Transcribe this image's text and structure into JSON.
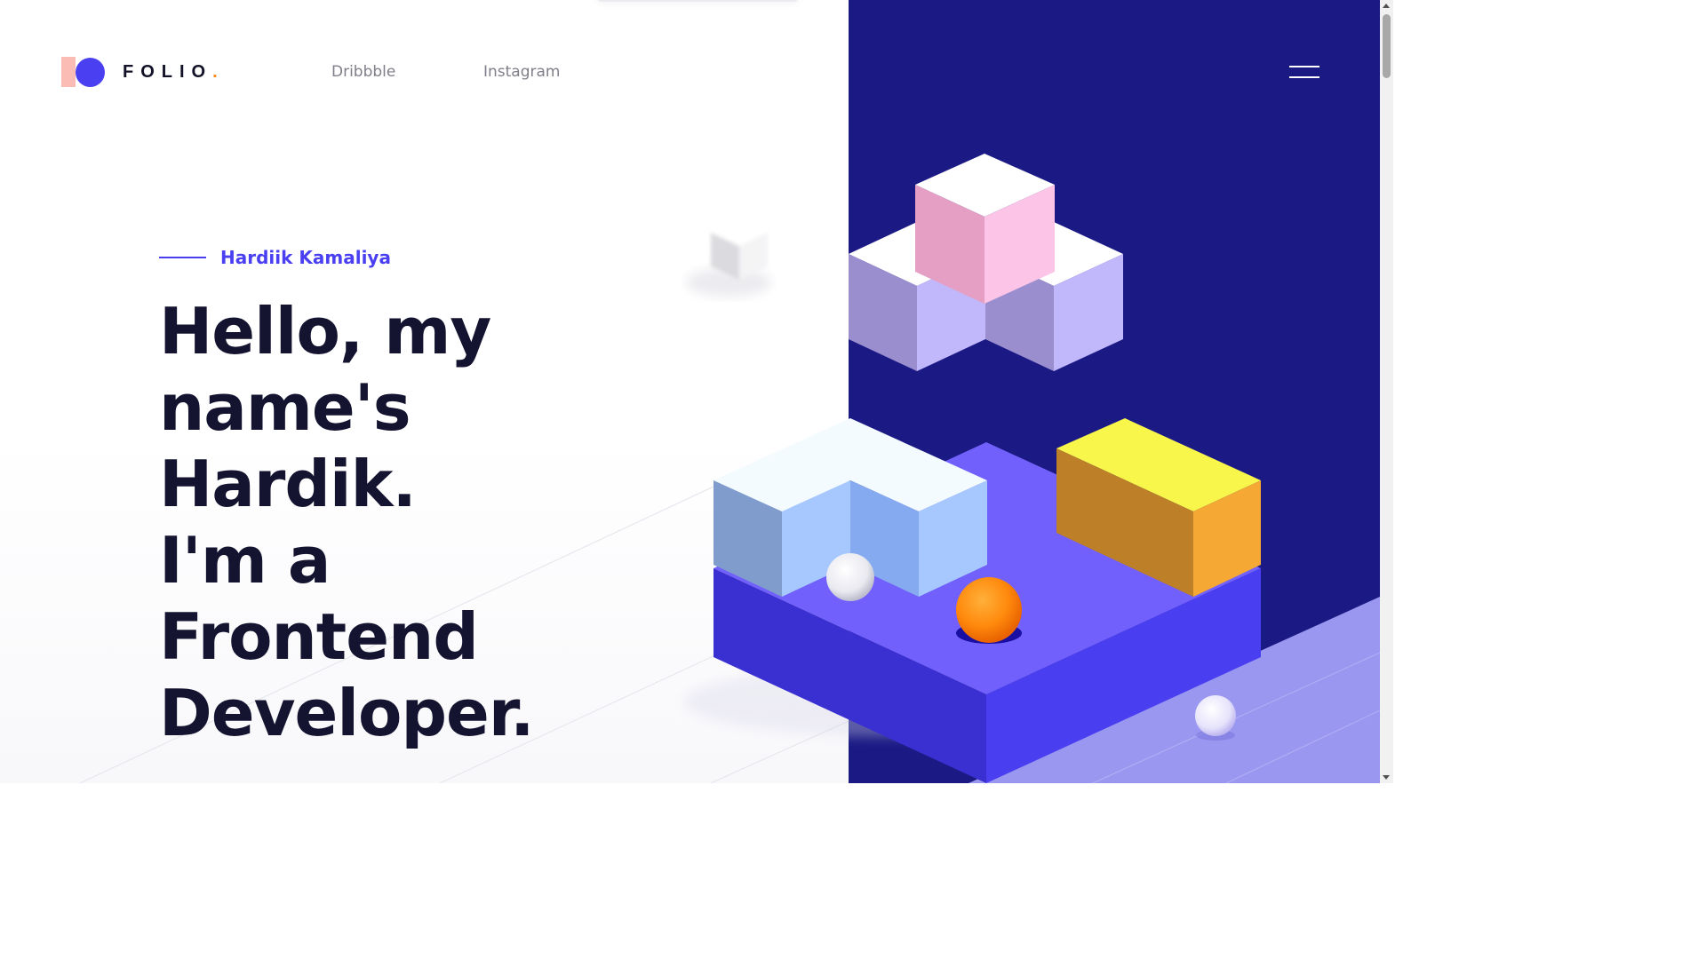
{
  "brand": {
    "name": "FOLIO",
    "dot": ".",
    "colors": {
      "accent": "#4a40f2",
      "pink": "#fbbcb6",
      "orange_dot": "#f28a1c",
      "panel": "#1b1a85"
    }
  },
  "nav": {
    "links": [
      {
        "label": "Dribbble"
      },
      {
        "label": "Instagram"
      }
    ],
    "menu_icon": "hamburger-menu-icon"
  },
  "hero": {
    "eyebrow": "Hardiik Kamaliya",
    "lines": [
      "Hello, my",
      "name's",
      "Hardik.",
      "I'm a",
      "Frontend",
      "Developer."
    ]
  },
  "illustration": {
    "description_icon": "isometric-blocks-illustration",
    "colors": {
      "white_cube": "#ffffff",
      "pink_cube": "#fbc3e6",
      "lavender_cube": "#c1b7fb",
      "blue_block": "#a6c8ff",
      "base_top": "#7160fb",
      "base_side": "#3a2fd0",
      "yellow_top": "#f9f64b",
      "yellow_side": "#f5a834",
      "orange_ball": "#ff8b10"
    }
  }
}
